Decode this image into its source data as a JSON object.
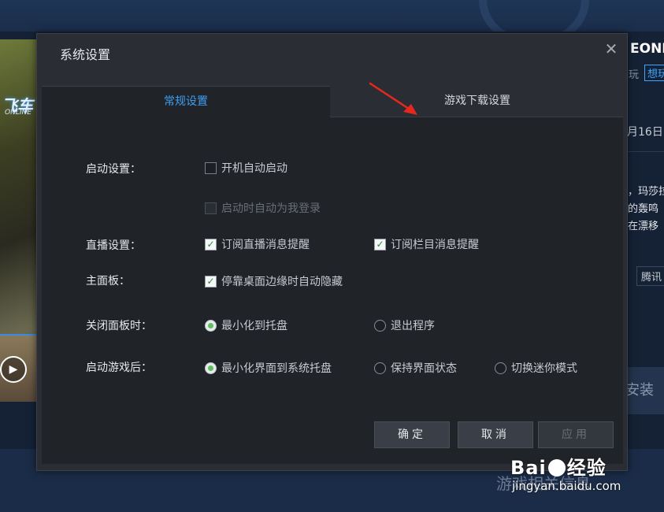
{
  "background": {
    "game_logo": "飞车",
    "game_logo_sub": "ONLINE",
    "game_title": "EONL",
    "sub_text": "玩",
    "tag": "想玩",
    "date": "月16日",
    "desc_lines": [
      "，玛莎拉",
      "的轰鸣",
      "在漂移"
    ],
    "chip": "腾讯",
    "install": "安装",
    "section_title": "游戏相关信息"
  },
  "watermark": {
    "brand_left": "Bai",
    "brand_right": "经验",
    "site": "jingyan.baidu.com"
  },
  "dialog": {
    "title": "系统设置",
    "close_glyph": "✕",
    "tabs": [
      {
        "label": "常规设置",
        "active": true
      },
      {
        "label": "游戏下载设置",
        "active": false
      }
    ],
    "rows": {
      "startup": {
        "label": "启动设置：",
        "auto_start": {
          "label": "开机自动启动",
          "checked": false
        },
        "auto_login": {
          "label": "启动时自动为我登录",
          "checked": false,
          "disabled": true
        }
      },
      "live": {
        "label": "直播设置：",
        "subscribe_live": {
          "label": "订阅直播消息提醒",
          "checked": true
        },
        "subscribe_column": {
          "label": "订阅栏目消息提醒",
          "checked": true
        }
      },
      "panel": {
        "label": "主面板：",
        "auto_hide": {
          "label": "停靠桌面边缘时自动隐藏",
          "checked": true
        }
      },
      "close_panel": {
        "label": "关闭面板时：",
        "options": [
          {
            "label": "最小化到托盘",
            "selected": true
          },
          {
            "label": "退出程序",
            "selected": false
          }
        ]
      },
      "after_launch": {
        "label": "启动游戏后：",
        "options": [
          {
            "label": "最小化界面到系统托盘",
            "selected": true
          },
          {
            "label": "保持界面状态",
            "selected": false
          },
          {
            "label": "切换迷你模式",
            "selected": false
          }
        ]
      }
    },
    "buttons": {
      "ok": "确定",
      "cancel": "取消",
      "apply": "应用"
    }
  },
  "colors": {
    "accent": "#3d9ff2",
    "annotation_arrow": "#e8271e",
    "check_green": "#2a8a3a"
  }
}
